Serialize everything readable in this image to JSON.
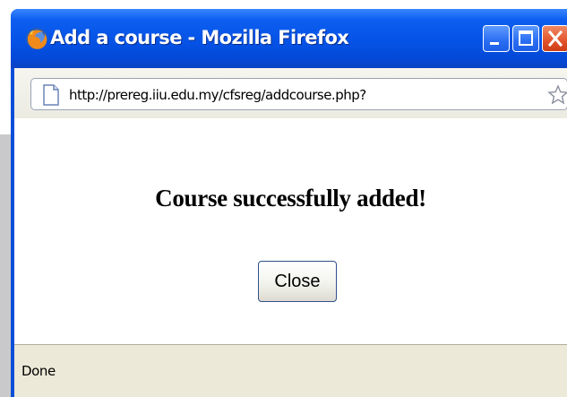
{
  "window": {
    "title": "Add a course - Mozilla Firefox",
    "app_icon": "firefox-icon",
    "controls": {
      "minimize_icon": "minimize-icon",
      "maximize_icon": "maximize-icon",
      "close_icon": "close-icon"
    }
  },
  "address_bar": {
    "url": "http://prereg.iiu.edu.my/cfsreg/addcourse.php?",
    "page_icon": "page-icon",
    "bookmark_icon": "star-icon"
  },
  "content": {
    "message": "Course successfully added!",
    "close_button_label": "Close"
  },
  "status_bar": {
    "text": "Done"
  },
  "colors": {
    "titlebar": "#0553e6",
    "close_button_red": "#e2532b",
    "chrome_bg": "#ece9d8"
  }
}
